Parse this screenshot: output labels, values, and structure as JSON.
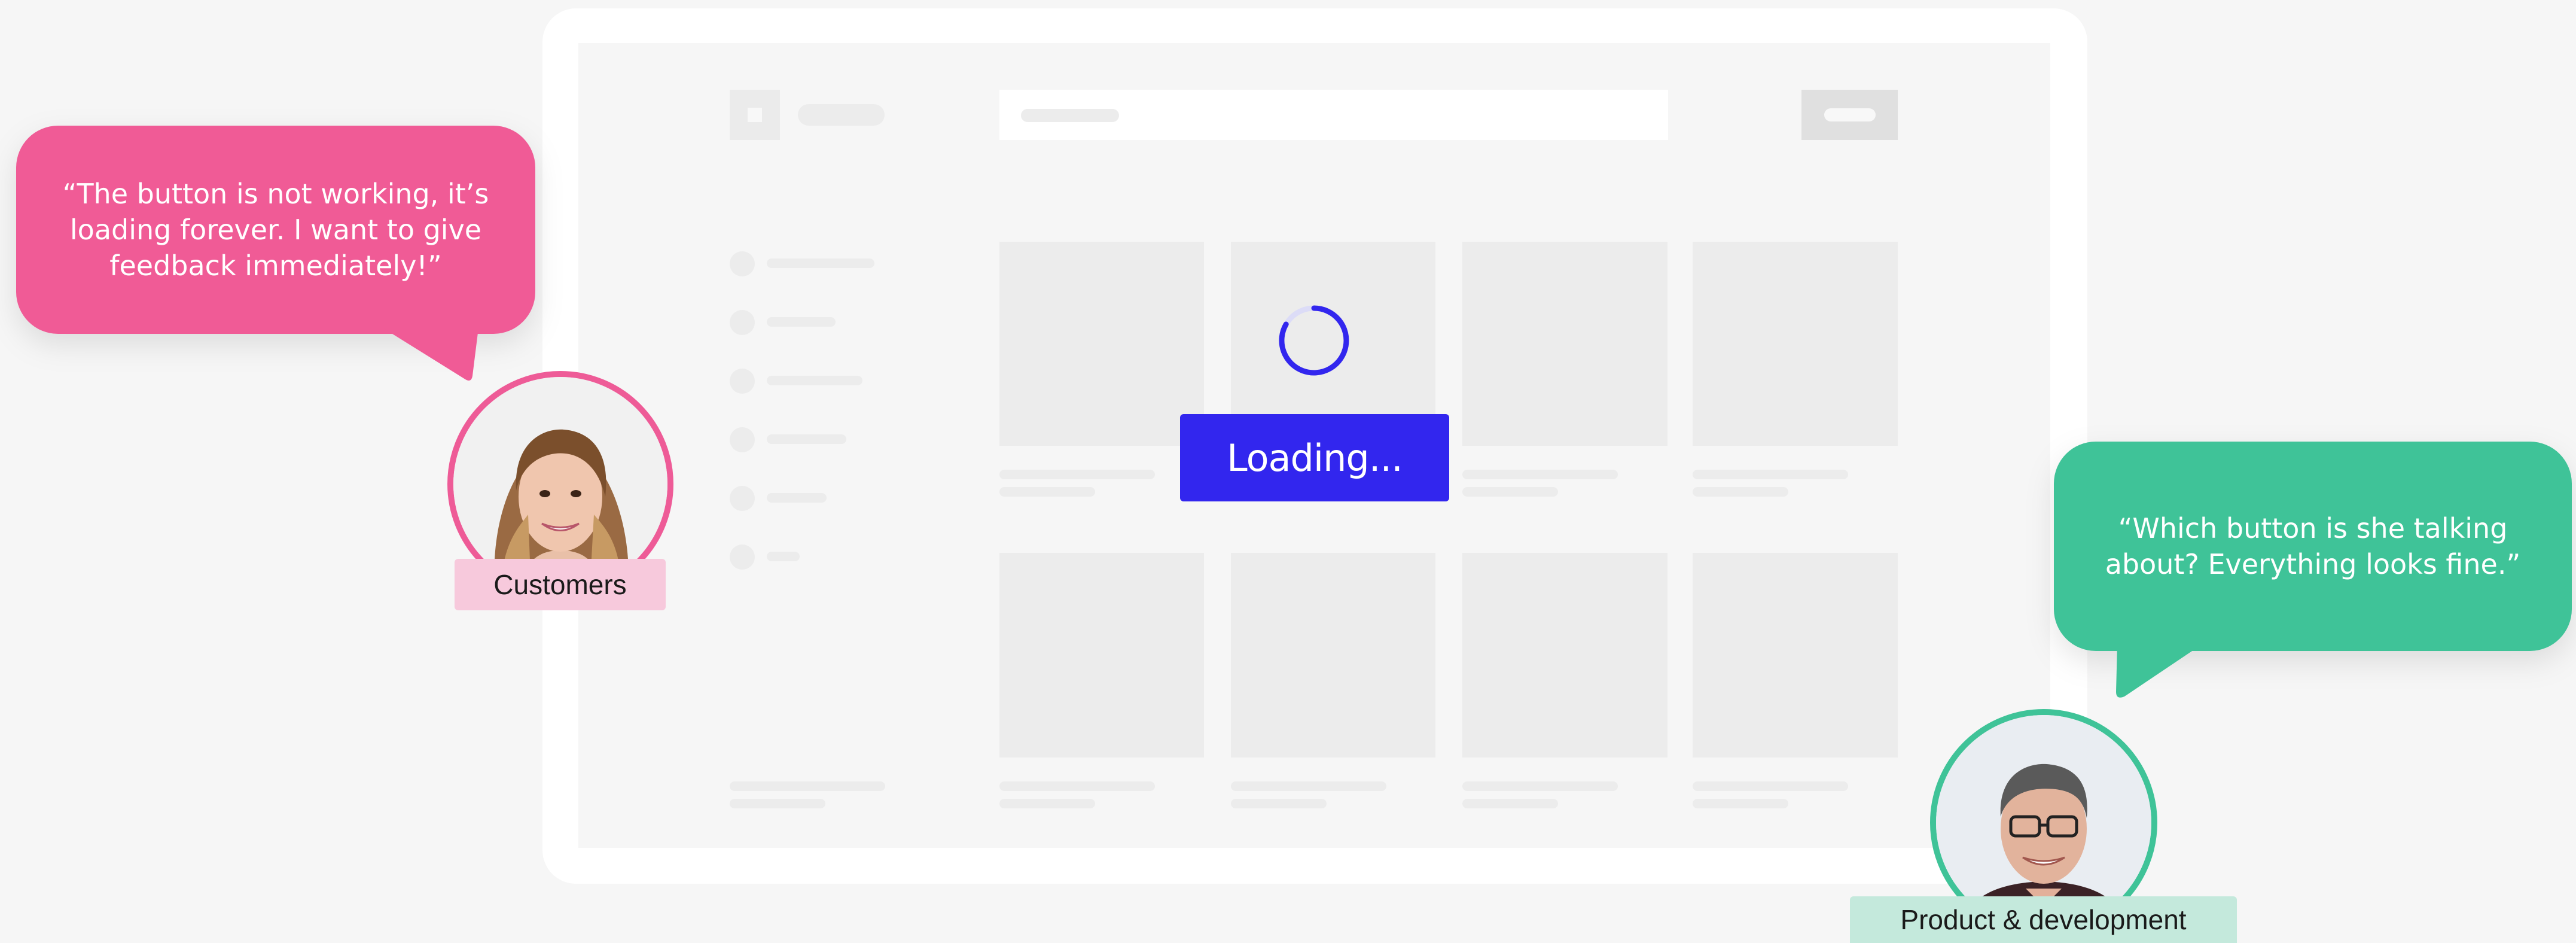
{
  "scene": {
    "loading_button": {
      "label": "Loading..."
    },
    "spinner_icon": "loading-spinner-icon"
  },
  "customer": {
    "quote": "“The button is not working, it’s\nloading forever. I want to give\nfeedback immediately!”",
    "label": "Customers",
    "accent_color": "#f05b96"
  },
  "product": {
    "quote": "“Which button is she talking\nabout? Everything looks fine.”",
    "label": "Product & development",
    "accent_color": "#3fc398"
  },
  "colors": {
    "background": "#f6f6f6",
    "frame": "#ffffff",
    "skeleton": "#ececec",
    "button": "#3226ee"
  }
}
